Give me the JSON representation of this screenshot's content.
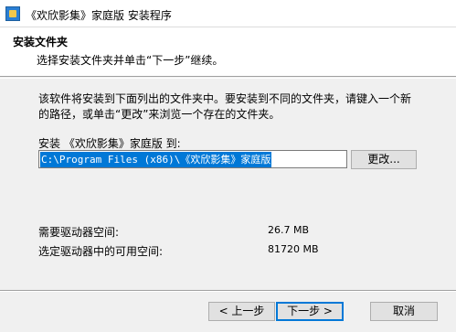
{
  "window": {
    "title": "《欢欣影集》家庭版 安装程序",
    "icon": "installer-app-icon"
  },
  "header": {
    "title": "安装文件夹",
    "subtitle": "选择安装文件夹并单击“下一步”继续。"
  },
  "body": {
    "description_line1": "该软件将安装到下面列出的文件夹中。要安装到不同的文件夹，请键入一个新",
    "description_line2": "的路径，或单击“更改”来浏览一个存在的文件夹。",
    "install_to_label": "安装 《欢欣影集》家庭版 到:",
    "install_path": "C:\\Program Files (x86)\\《欢欣影集》家庭版",
    "browse_label": "更改...",
    "required_space_label": "需要驱动器空间:",
    "required_space_value": "26.7 MB",
    "available_space_label": "选定驱动器中的可用空间:",
    "available_space_value": "81720 MB"
  },
  "footer": {
    "back_label": "< 上一步",
    "next_label": "下一步 >",
    "cancel_label": "取消"
  },
  "colors": {
    "selection": "#0078d7",
    "dialog_bg": "#f0f0f0",
    "header_bg": "#ffffff"
  }
}
